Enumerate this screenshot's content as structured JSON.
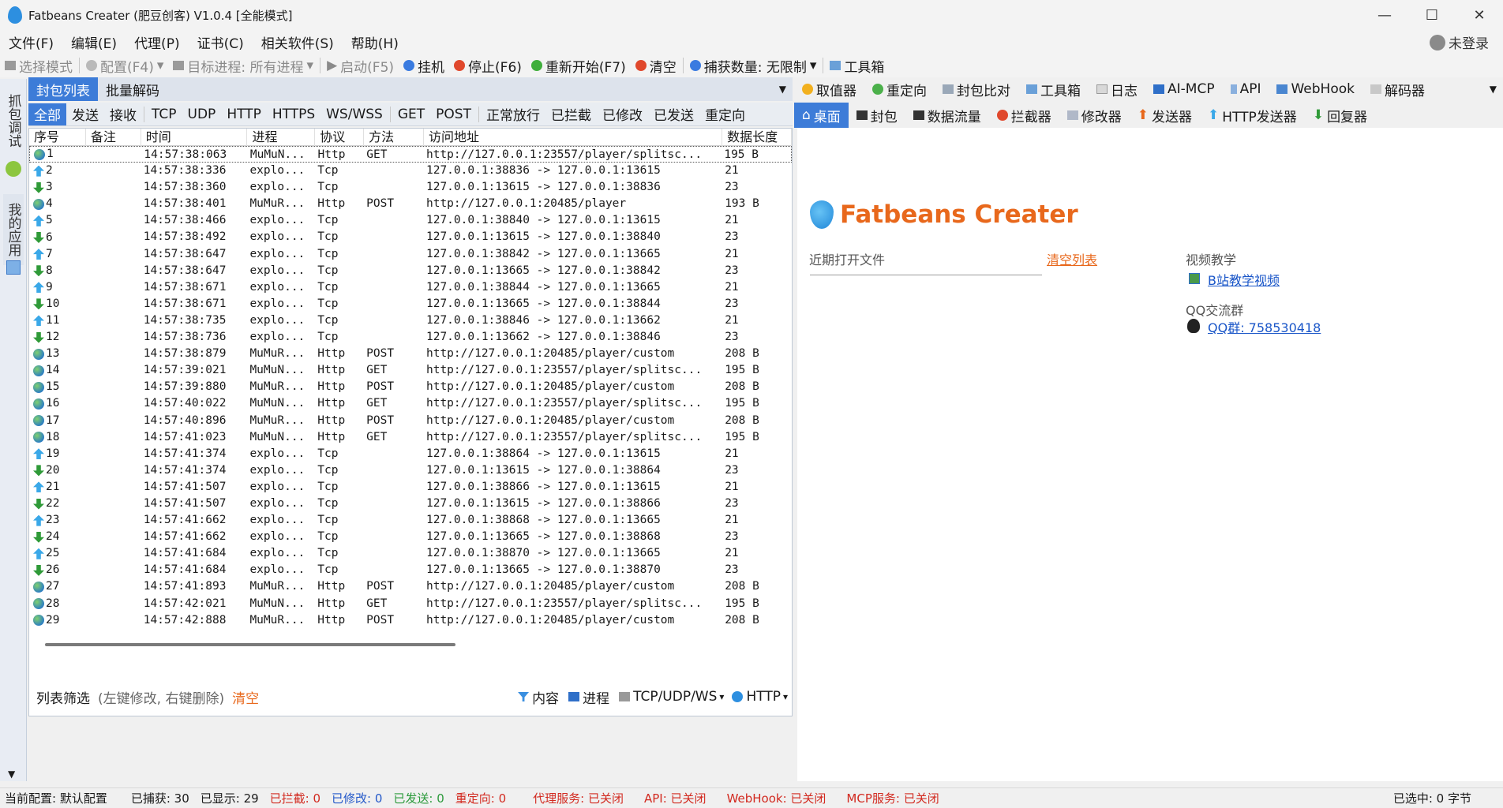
{
  "window": {
    "title": "Fatbeans Creater (肥豆创客) V1.0.4 [全能模式]",
    "min": "—",
    "max": "☐",
    "close": "✕"
  },
  "menu": [
    "文件(F)",
    "编辑(E)",
    "代理(P)",
    "证书(C)",
    "相关软件(S)",
    "帮助(H)"
  ],
  "login": "未登录",
  "toolbar": {
    "select_mode": "选择模式",
    "config": "配置(F4)",
    "target": "目标进程: 所有进程",
    "start": "启动(F5)",
    "hang": "挂机",
    "stop": "停止(F6)",
    "restart": "重新开始(F7)",
    "clear": "清空",
    "capture": "捕获数量: 无限制",
    "toolbox": "工具箱"
  },
  "leftstrip": [
    "抓包调试",
    "我的应用"
  ],
  "panel_tabs": [
    "封包列表",
    "批量解码"
  ],
  "filters": [
    "全部",
    "发送",
    "接收",
    "TCP",
    "UDP",
    "HTTP",
    "HTTPS",
    "WS/WSS",
    "GET",
    "POST",
    "正常放行",
    "已拦截",
    "已修改",
    "已发送",
    "重定向"
  ],
  "columns": [
    "序号",
    "备注",
    "时间",
    "进程",
    "协议",
    "方法",
    "访问地址",
    "数据长度"
  ],
  "rows": [
    {
      "icon": "globe",
      "id": "1",
      "time": "14:57:38:063",
      "proc": "MuMuN...",
      "proto": "Http",
      "method": "GET",
      "url": "http://127.0.0.1:23557/player/splitsc...",
      "len": "195 B"
    },
    {
      "icon": "up",
      "id": "2",
      "time": "14:57:38:336",
      "proc": "explo...",
      "proto": "Tcp",
      "method": "",
      "url": "127.0.0.1:38836 -> 127.0.0.1:13615",
      "len": "21"
    },
    {
      "icon": "down",
      "id": "3",
      "time": "14:57:38:360",
      "proc": "explo...",
      "proto": "Tcp",
      "method": "",
      "url": "127.0.0.1:13615 -> 127.0.0.1:38836",
      "len": "23"
    },
    {
      "icon": "globe",
      "id": "4",
      "time": "14:57:38:401",
      "proc": "MuMuR...",
      "proto": "Http",
      "method": "POST",
      "url": "http://127.0.0.1:20485/player",
      "len": "193 B"
    },
    {
      "icon": "up",
      "id": "5",
      "time": "14:57:38:466",
      "proc": "explo...",
      "proto": "Tcp",
      "method": "",
      "url": "127.0.0.1:38840 -> 127.0.0.1:13615",
      "len": "21"
    },
    {
      "icon": "down",
      "id": "6",
      "time": "14:57:38:492",
      "proc": "explo...",
      "proto": "Tcp",
      "method": "",
      "url": "127.0.0.1:13615 -> 127.0.0.1:38840",
      "len": "23"
    },
    {
      "icon": "up",
      "id": "7",
      "time": "14:57:38:647",
      "proc": "explo...",
      "proto": "Tcp",
      "method": "",
      "url": "127.0.0.1:38842 -> 127.0.0.1:13665",
      "len": "21"
    },
    {
      "icon": "down",
      "id": "8",
      "time": "14:57:38:647",
      "proc": "explo...",
      "proto": "Tcp",
      "method": "",
      "url": "127.0.0.1:13665 -> 127.0.0.1:38842",
      "len": "23"
    },
    {
      "icon": "up",
      "id": "9",
      "time": "14:57:38:671",
      "proc": "explo...",
      "proto": "Tcp",
      "method": "",
      "url": "127.0.0.1:38844 -> 127.0.0.1:13665",
      "len": "21"
    },
    {
      "icon": "down",
      "id": "10",
      "time": "14:57:38:671",
      "proc": "explo...",
      "proto": "Tcp",
      "method": "",
      "url": "127.0.0.1:13665 -> 127.0.0.1:38844",
      "len": "23"
    },
    {
      "icon": "up",
      "id": "11",
      "time": "14:57:38:735",
      "proc": "explo...",
      "proto": "Tcp",
      "method": "",
      "url": "127.0.0.1:38846 -> 127.0.0.1:13662",
      "len": "21"
    },
    {
      "icon": "down",
      "id": "12",
      "time": "14:57:38:736",
      "proc": "explo...",
      "proto": "Tcp",
      "method": "",
      "url": "127.0.0.1:13662 -> 127.0.0.1:38846",
      "len": "23"
    },
    {
      "icon": "globe",
      "id": "13",
      "time": "14:57:38:879",
      "proc": "MuMuR...",
      "proto": "Http",
      "method": "POST",
      "url": "http://127.0.0.1:20485/player/custom",
      "len": "208 B"
    },
    {
      "icon": "globe",
      "id": "14",
      "time": "14:57:39:021",
      "proc": "MuMuN...",
      "proto": "Http",
      "method": "GET",
      "url": "http://127.0.0.1:23557/player/splitsc...",
      "len": "195 B"
    },
    {
      "icon": "globe",
      "id": "15",
      "time": "14:57:39:880",
      "proc": "MuMuR...",
      "proto": "Http",
      "method": "POST",
      "url": "http://127.0.0.1:20485/player/custom",
      "len": "208 B"
    },
    {
      "icon": "globe",
      "id": "16",
      "time": "14:57:40:022",
      "proc": "MuMuN...",
      "proto": "Http",
      "method": "GET",
      "url": "http://127.0.0.1:23557/player/splitsc...",
      "len": "195 B"
    },
    {
      "icon": "globe",
      "id": "17",
      "time": "14:57:40:896",
      "proc": "MuMuR...",
      "proto": "Http",
      "method": "POST",
      "url": "http://127.0.0.1:20485/player/custom",
      "len": "208 B"
    },
    {
      "icon": "globe",
      "id": "18",
      "time": "14:57:41:023",
      "proc": "MuMuN...",
      "proto": "Http",
      "method": "GET",
      "url": "http://127.0.0.1:23557/player/splitsc...",
      "len": "195 B"
    },
    {
      "icon": "up",
      "id": "19",
      "time": "14:57:41:374",
      "proc": "explo...",
      "proto": "Tcp",
      "method": "",
      "url": "127.0.0.1:38864 -> 127.0.0.1:13615",
      "len": "21"
    },
    {
      "icon": "down",
      "id": "20",
      "time": "14:57:41:374",
      "proc": "explo...",
      "proto": "Tcp",
      "method": "",
      "url": "127.0.0.1:13615 -> 127.0.0.1:38864",
      "len": "23"
    },
    {
      "icon": "up",
      "id": "21",
      "time": "14:57:41:507",
      "proc": "explo...",
      "proto": "Tcp",
      "method": "",
      "url": "127.0.0.1:38866 -> 127.0.0.1:13615",
      "len": "21"
    },
    {
      "icon": "down",
      "id": "22",
      "time": "14:57:41:507",
      "proc": "explo...",
      "proto": "Tcp",
      "method": "",
      "url": "127.0.0.1:13615 -> 127.0.0.1:38866",
      "len": "23"
    },
    {
      "icon": "up",
      "id": "23",
      "time": "14:57:41:662",
      "proc": "explo...",
      "proto": "Tcp",
      "method": "",
      "url": "127.0.0.1:38868 -> 127.0.0.1:13665",
      "len": "21"
    },
    {
      "icon": "down",
      "id": "24",
      "time": "14:57:41:662",
      "proc": "explo...",
      "proto": "Tcp",
      "method": "",
      "url": "127.0.0.1:13665 -> 127.0.0.1:38868",
      "len": "23"
    },
    {
      "icon": "up",
      "id": "25",
      "time": "14:57:41:684",
      "proc": "explo...",
      "proto": "Tcp",
      "method": "",
      "url": "127.0.0.1:38870 -> 127.0.0.1:13665",
      "len": "21"
    },
    {
      "icon": "down",
      "id": "26",
      "time": "14:57:41:684",
      "proc": "explo...",
      "proto": "Tcp",
      "method": "",
      "url": "127.0.0.1:13665 -> 127.0.0.1:38870",
      "len": "23"
    },
    {
      "icon": "globe",
      "id": "27",
      "time": "14:57:41:893",
      "proc": "MuMuR...",
      "proto": "Http",
      "method": "POST",
      "url": "http://127.0.0.1:20485/player/custom",
      "len": "208 B"
    },
    {
      "icon": "globe",
      "id": "28",
      "time": "14:57:42:021",
      "proc": "MuMuN...",
      "proto": "Http",
      "method": "GET",
      "url": "http://127.0.0.1:23557/player/splitsc...",
      "len": "195 B"
    },
    {
      "icon": "globe",
      "id": "29",
      "time": "14:57:42:888",
      "proc": "MuMuR...",
      "proto": "Http",
      "method": "POST",
      "url": "http://127.0.0.1:20485/player/custom",
      "len": "208 B"
    }
  ],
  "listfilter": {
    "label": "列表筛选",
    "hint": "(左键修改, 右键删除)",
    "clear": "清空",
    "content": "内容",
    "process": "进程",
    "tcp": "TCP/UDP/WS",
    "http": "HTTP"
  },
  "right_toolbar": [
    "取值器",
    "重定向",
    "封包比对",
    "工具箱",
    "日志",
    "AI-MCP",
    "API",
    "WebHook",
    "解码器"
  ],
  "right_tabs": [
    "桌面",
    "封包",
    "数据流量",
    "拦截器",
    "修改器",
    "发送器",
    "HTTP发送器",
    "回复器"
  ],
  "desktop": {
    "brand": "Fatbeans Creater",
    "recent": "近期打开文件",
    "clear_list": "清空列表",
    "video": "视频教学",
    "video_link": "B站教学视频",
    "qq": "QQ交流群",
    "qq_link": "QQ群: 758530418"
  },
  "status": {
    "config": "当前配置: 默认配置",
    "captured": "已捕获: 30",
    "shown": "已显示: 29",
    "intercepted": "已拦截: 0",
    "modified": "已修改: 0",
    "sent": "已发送: 0",
    "redirect": "重定向: 0",
    "proxy": "代理服务: 已关闭",
    "api": "API: 已关闭",
    "webhook": "WebHook: 已关闭",
    "mcp": "MCP服务: 已关闭",
    "selected": "已选中: 0 字节"
  }
}
